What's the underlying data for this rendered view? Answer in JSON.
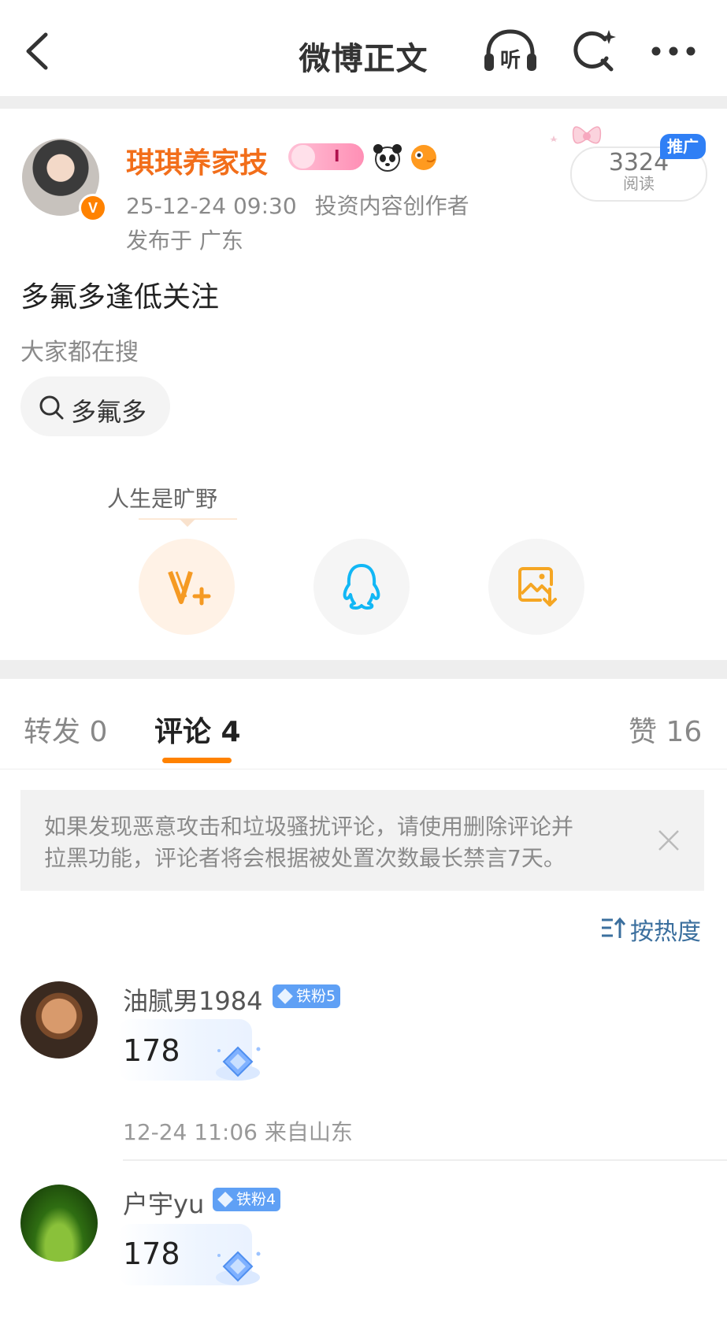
{
  "header": {
    "title": "微博正文",
    "listen_label": "听"
  },
  "post": {
    "author_name": "琪琪养家技",
    "verified_mark": "V",
    "time": "25-12-24 09:30",
    "author_role": "投资内容创作者",
    "location": "发布于 广东",
    "read_count": "3324",
    "read_label": "阅读",
    "promo_badge": "推广",
    "badge_letter": "I",
    "content": "多氟多逢低关注",
    "search_header": "大家都在搜",
    "search_chip": "多氟多",
    "share_tooltip": "人生是旷野"
  },
  "tabs": [
    {
      "label": "转发 0",
      "active": false
    },
    {
      "label": "评论 4",
      "active": true
    },
    {
      "label": "赞 16",
      "active": false
    }
  ],
  "notice": {
    "line1": "如果发现恶意攻击和垃圾骚扰评论，请使用删除评论并",
    "line2": "拉黑功能，评论者将会根据被处置次数最长禁言7天。"
  },
  "sort_label": "按热度",
  "comments": [
    {
      "user": "油腻男1984",
      "badge": "铁粉5",
      "text": "178",
      "meta": "12-24 11:06 来自山东"
    },
    {
      "user": "户宇yu",
      "badge": "铁粉4",
      "text": "178"
    }
  ],
  "colors": {
    "accent": "#ff8200",
    "username": "#f26e1a",
    "link_blue": "#3b6f9e",
    "fan_badge": "#5fa0f5",
    "promo_blue": "#2f7ff5"
  }
}
